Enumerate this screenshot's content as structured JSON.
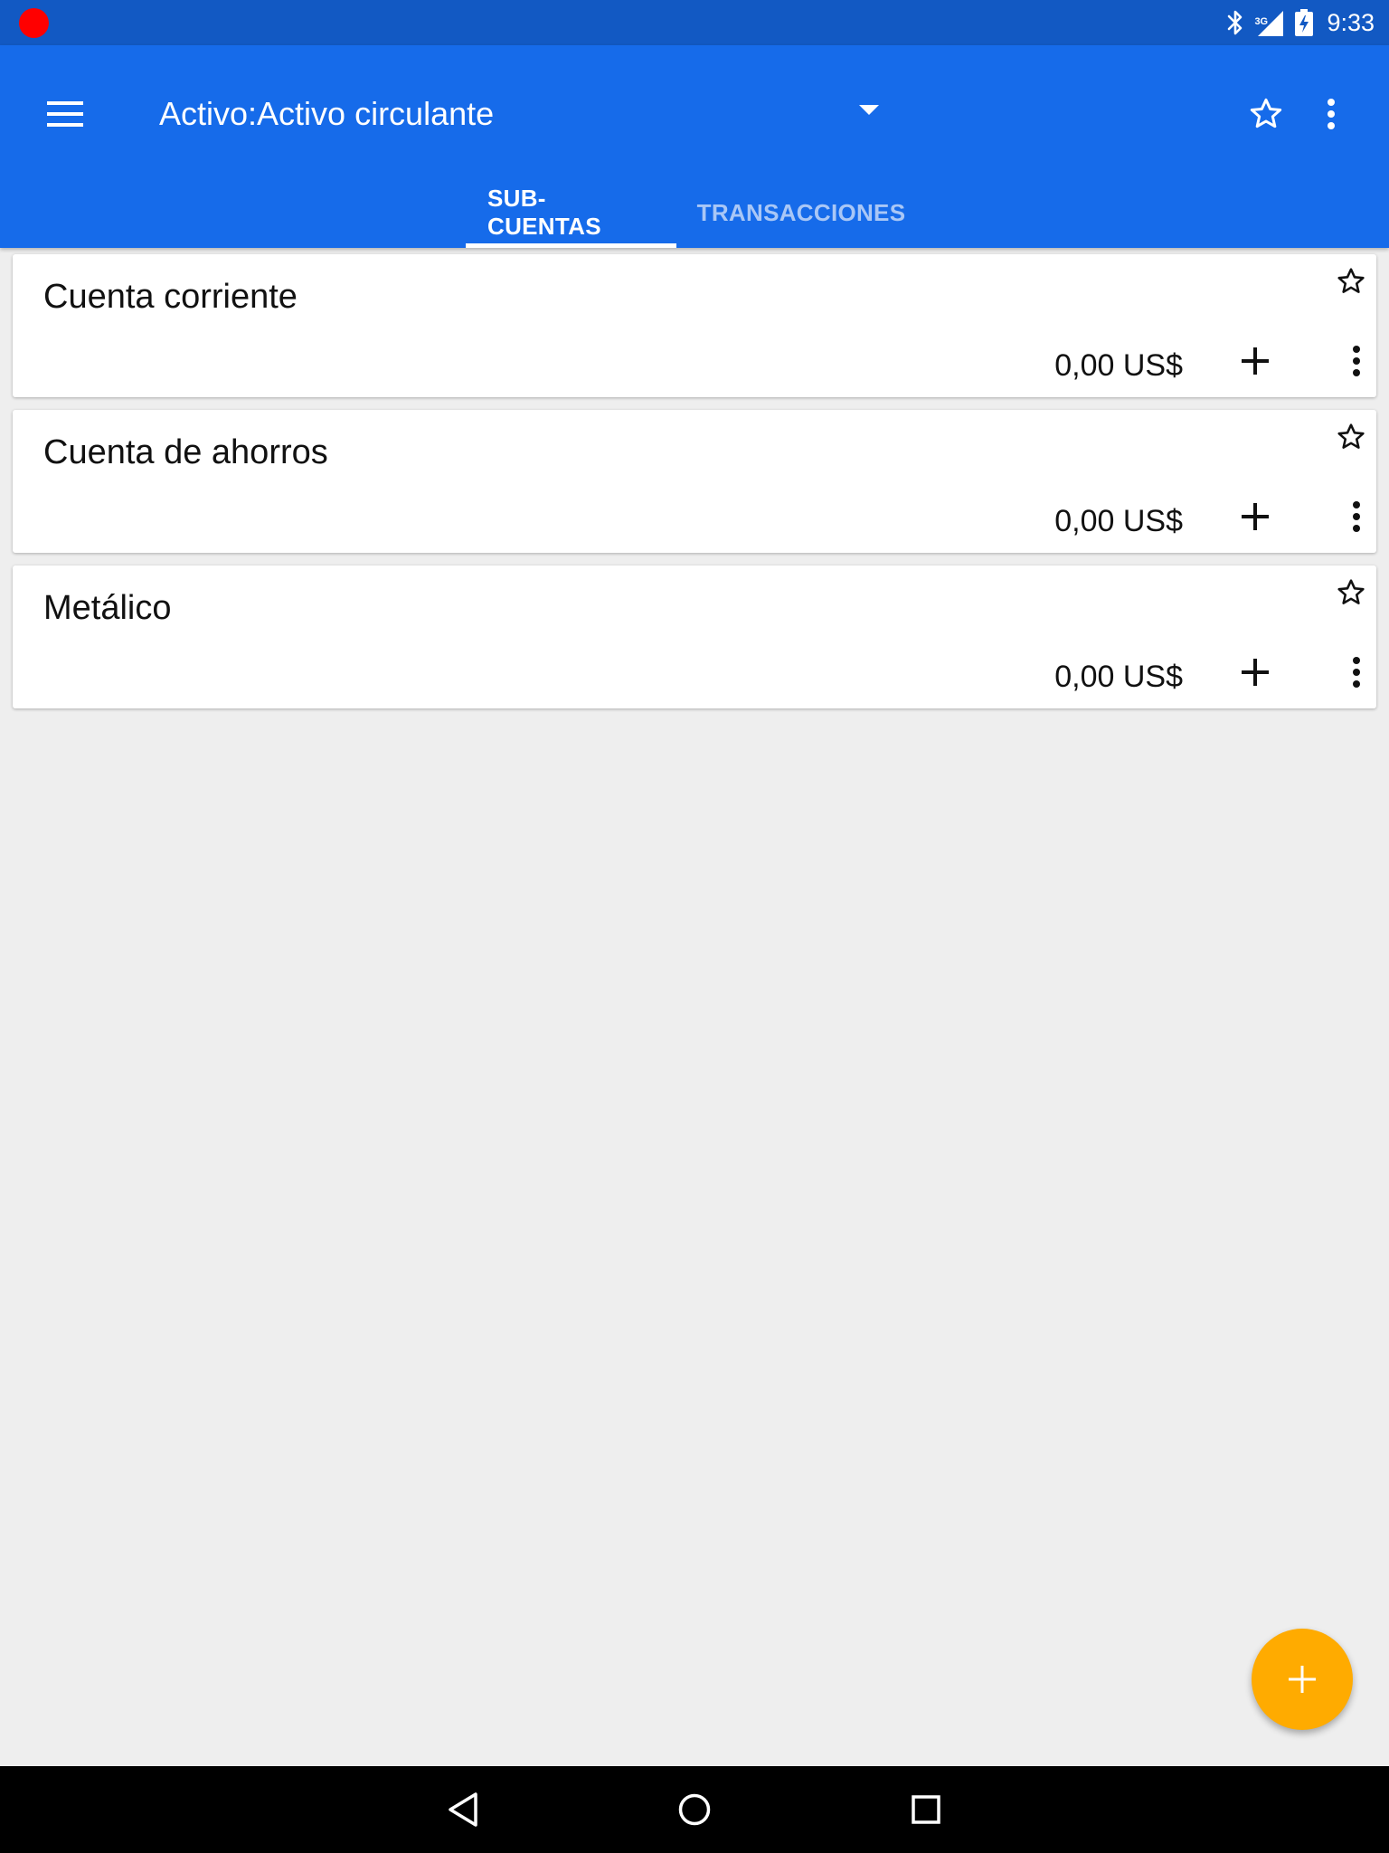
{
  "status_bar": {
    "network_type": "3G",
    "time": "9:33",
    "icons": [
      "recording-dot",
      "bluetooth-icon",
      "cell-signal-icon",
      "battery-charging-icon"
    ]
  },
  "app_bar": {
    "title": "Activo:Activo circulante",
    "icons": [
      "menu-icon",
      "dropdown-arrow-icon",
      "star-outline-icon",
      "more-vert-icon"
    ],
    "tabs": [
      {
        "label": "SUB-CUENTAS",
        "active": true
      },
      {
        "label": "TRANSACCIONES",
        "active": false
      }
    ]
  },
  "accounts": [
    {
      "name": "Cuenta corriente",
      "balance": "0,00 US$"
    },
    {
      "name": "Cuenta de ahorros",
      "balance": "0,00 US$"
    },
    {
      "name": "Metálico",
      "balance": "0,00 US$"
    }
  ],
  "colors": {
    "status_bar": "#1259c3",
    "app_bar": "#166bea",
    "tab_inactive_text": "#a9c7f6",
    "fab": "#ffab00",
    "background": "#eeeeee",
    "recording_dot": "#ff0000"
  },
  "fab": {
    "icon": "plus-icon"
  },
  "nav_bar": {
    "icons": [
      "back-icon",
      "home-icon",
      "recents-icon"
    ]
  }
}
